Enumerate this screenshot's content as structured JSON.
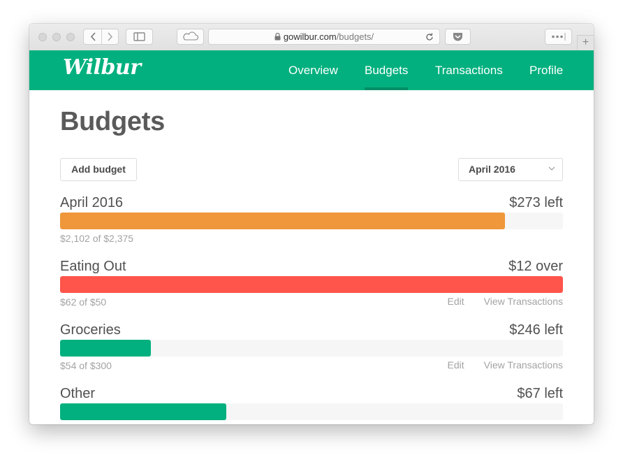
{
  "browser": {
    "url_domain": "gowilbur.com",
    "url_path": "/budgets/",
    "new_tab_label": "+"
  },
  "nav": {
    "logo": "Wilbur",
    "items": [
      {
        "label": "Overview"
      },
      {
        "label": "Budgets",
        "active": true
      },
      {
        "label": "Transactions"
      },
      {
        "label": "Profile"
      }
    ]
  },
  "page": {
    "title": "Budgets",
    "add_button": "Add budget",
    "period_select": "April 2016"
  },
  "budgets": [
    {
      "name": "April 2016",
      "status": "$273 left",
      "amount": "$2,102 of $2,375",
      "progress": 0.885,
      "color": "#ef973a",
      "edit": "",
      "view": ""
    },
    {
      "name": "Eating Out",
      "status": "$12 over",
      "amount": "$62 of $50",
      "progress": 1.0,
      "color": "#ff554b",
      "edit": "Edit",
      "view": "View Transactions"
    },
    {
      "name": "Groceries",
      "status": "$246 left",
      "amount": "$54 of $300",
      "progress": 0.18,
      "color": "#01b07e",
      "edit": "Edit",
      "view": "View Transactions"
    },
    {
      "name": "Other",
      "status": "$67 left",
      "amount": "",
      "progress": 0.33,
      "color": "#01b07e",
      "edit": "",
      "view": ""
    }
  ],
  "colors": {
    "brand": "#01b07e",
    "over": "#ff554b",
    "warn": "#ef973a"
  }
}
